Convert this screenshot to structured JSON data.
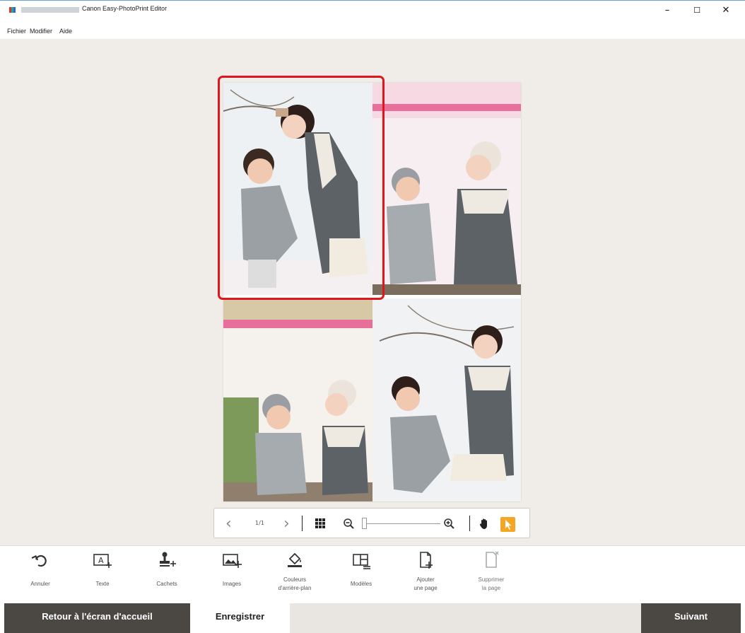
{
  "window": {
    "title": "Canon Easy-PhotoPrint Editor",
    "minimize": "–",
    "maximize": "☐",
    "close": "✕"
  },
  "menu": [
    "Fichier",
    "Modifier",
    "Aide"
  ],
  "navigation": {
    "page_indicator": "1/1",
    "prev": "‹",
    "next": "›"
  },
  "tools": [
    {
      "label": "Annuler",
      "icon": "undo-icon"
    },
    {
      "label": "Texte",
      "icon": "text-add-icon"
    },
    {
      "label": "Cachets",
      "icon": "stamp-icon"
    },
    {
      "label": "Images",
      "icon": "image-add-icon"
    },
    {
      "label": "Couleurs\nd'arrière-plan",
      "line1": "Couleurs",
      "line2": "d'arrière-plan",
      "icon": "fill-bucket-icon"
    },
    {
      "label": "Modèles",
      "icon": "templates-icon"
    },
    {
      "label": "Ajouter\nune page",
      "line1": "Ajouter",
      "line2": "une page",
      "icon": "add-page-icon"
    },
    {
      "label": "Supprimer\nla page",
      "line1": "Supprimer",
      "line2": "la page",
      "icon": "delete-page-icon"
    }
  ],
  "footer": {
    "home": "Retour à l'écran d'accueil",
    "save": "Enregistrer",
    "next": "Suivant"
  },
  "colors": {
    "accent": "#f5a623",
    "selection": "#e0161c",
    "footer_dark": "#4b4844"
  }
}
